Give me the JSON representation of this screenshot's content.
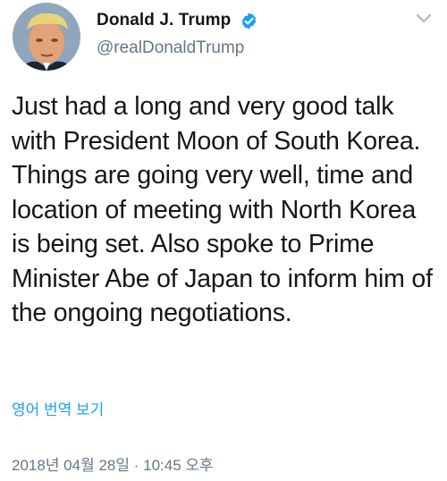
{
  "tweet": {
    "display_name": "Donald J. Trump",
    "handle": "@realDonaldTrump",
    "verified": true,
    "text": "Just had a long and very good talk with President Moon of South Korea. Things are going very well, time and location of meeting with North Korea is being set. Also spoke to Prime Minister Abe of Japan to inform him of the ongoing negotiations.",
    "translate_label": "영어 번역 보기",
    "timestamp": "2018년 04월 28일 · 10:45 오후"
  },
  "colors": {
    "text": "#14171a",
    "secondary": "#657786",
    "link": "#1da1f2",
    "verified_badge": "#1da1f2"
  },
  "icons": {
    "verified": "verified-badge-icon",
    "menu": "chevron-down-icon"
  }
}
